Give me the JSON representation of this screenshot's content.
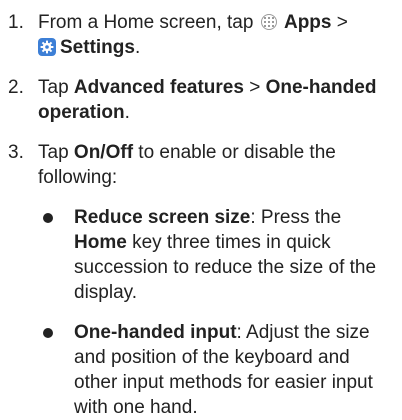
{
  "steps": [
    {
      "number": "1.",
      "prefix": "From a Home screen, tap ",
      "apps_label": "Apps",
      "sep": " >",
      "settings_label": "Settings",
      "suffix": "."
    },
    {
      "number": "2.",
      "prefix": "Tap ",
      "strong1": "Advanced features",
      "sep": " > ",
      "strong2": "One-handed operation",
      "suffix": "."
    },
    {
      "number": "3.",
      "prefix": "Tap ",
      "strong": "On/Off",
      "suffix": " to enable or disable the following:"
    }
  ],
  "bullets": [
    {
      "title": "Reduce screen size",
      "text1": ": Press the ",
      "strong": "Home",
      "text2": " key three times in quick succession to reduce the size of the display."
    },
    {
      "title": "One-handed input",
      "text1": ": Adjust the size and position of the keyboard and other input methods for easier input with one hand."
    }
  ],
  "icons": {
    "apps": "apps-grid-icon",
    "settings": "settings-gear-icon",
    "settings_color": "#3d7fd6"
  }
}
